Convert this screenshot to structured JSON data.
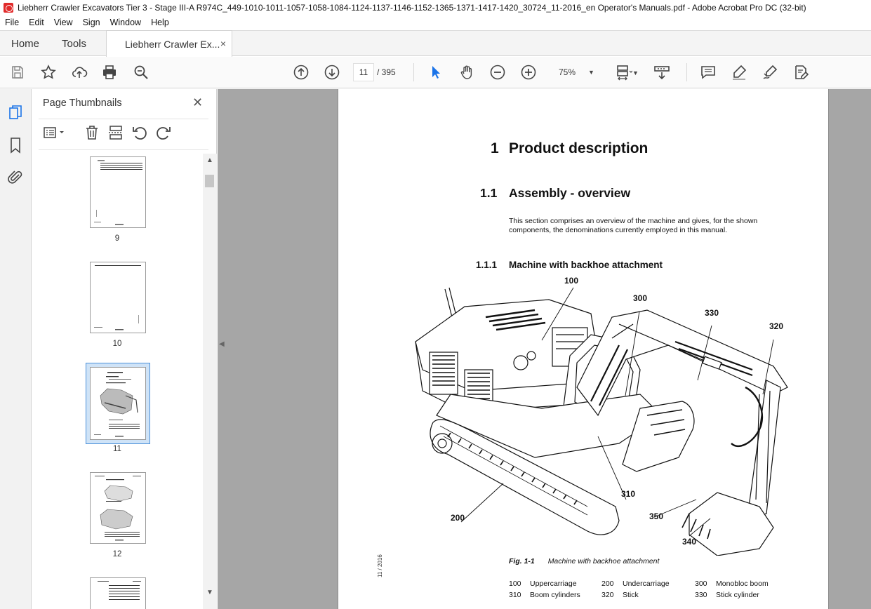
{
  "window": {
    "title": "Liebherr Crawler Excavators Tier 3 - Stage III-A R974C_449-1010-1011-1057-1058-1084-1124-1137-1146-1152-1365-1371-1417-1420_30724_11-2016_en Operator's Manuals.pdf - Adobe Acrobat Pro DC (32-bit)"
  },
  "menu": [
    "File",
    "Edit",
    "View",
    "Sign",
    "Window",
    "Help"
  ],
  "tabs": {
    "home": "Home",
    "tools": "Tools",
    "document": "Liebherr Crawler Ex...",
    "close_glyph": "×"
  },
  "toolbar": {
    "current_page": "11",
    "page_total": "/ 395",
    "zoom": "75%",
    "zoom_caret": "▼",
    "icons": [
      "save-icon",
      "star-icon",
      "share-upload-icon",
      "print-icon",
      "find-zoom-icon",
      "previous-page-icon",
      "next-page-icon",
      "select-cursor-icon",
      "hand-icon",
      "zoom-out-icon",
      "zoom-in-icon",
      "page-fit-icon",
      "scroll-mode-icon",
      "comment-icon",
      "highlight-pen-icon",
      "sign-icon",
      "edit-pdf-icon"
    ]
  },
  "rail": {
    "icons": [
      "page-thumbnails-icon",
      "bookmark-icon",
      "attachment-icon"
    ]
  },
  "thumbnails_panel": {
    "title": "Page Thumbnails",
    "close_glyph": "✕",
    "tools": [
      "options-menu-icon",
      "delete-page-icon",
      "extract-page-icon",
      "rotate-ccw-icon",
      "rotate-cw-icon"
    ],
    "pages": [
      {
        "label": "9",
        "selected": false
      },
      {
        "label": "10",
        "selected": false
      },
      {
        "label": "11",
        "selected": true
      },
      {
        "label": "12",
        "selected": false
      }
    ]
  },
  "document_page": {
    "h1_num": "1",
    "h1_text": "Product description",
    "h2_num": "1.1",
    "h2_text": "Assembly - overview",
    "paragraph": "This section comprises an overview of the machine and gives, for the shown components, the denominations currently employed in this manual.",
    "h3_num": "1.1.1",
    "h3_text": "Machine with backhoe attachment",
    "callouts": [
      "100",
      "300",
      "330",
      "320",
      "310",
      "200",
      "350",
      "340"
    ],
    "caption_label": "Fig. 1-1",
    "caption_text": "Machine with backhoe attachment",
    "legend": [
      [
        {
          "code": "100",
          "name": "Uppercarriage"
        },
        {
          "code": "200",
          "name": "Undercarriage"
        },
        {
          "code": "300",
          "name": "Monobloc boom"
        }
      ],
      [
        {
          "code": "310",
          "name": "Boom cylinders"
        },
        {
          "code": "320",
          "name": "Stick"
        },
        {
          "code": "330",
          "name": "Stick cylinder"
        }
      ]
    ],
    "side_stamp": "11 / 2016"
  }
}
